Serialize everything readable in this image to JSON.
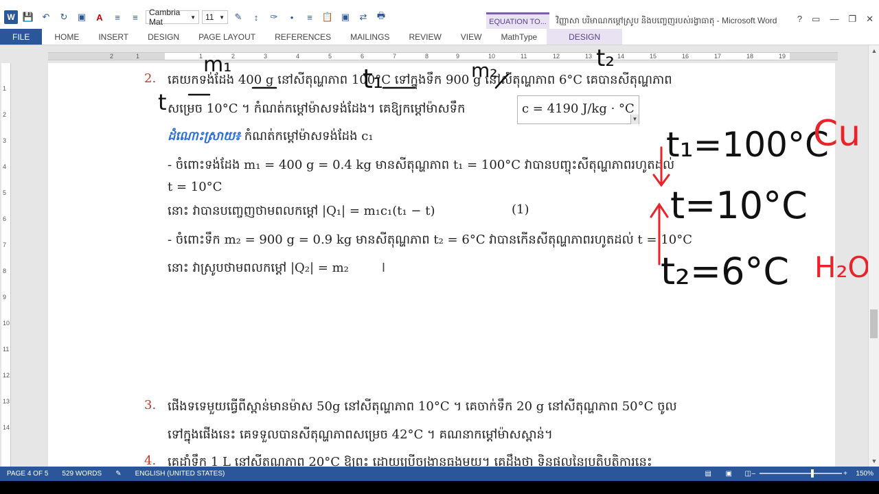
{
  "window": {
    "title": "វិញ្ញាសា បរិមាណកម្ដៅស្រូប និងបញ្ចេញរបស់រង្វាធាតុ - Microsoft Word",
    "controls": [
      "?",
      "▭",
      "—",
      "❐",
      "✕"
    ]
  },
  "quick_access": {
    "logo": "W",
    "font_name": "Cambria Mat",
    "font_size": "11"
  },
  "context_tab_header": "EQUATION TO...",
  "ribbon_tabs": [
    "FILE",
    "HOME",
    "INSERT",
    "DESIGN",
    "PAGE LAYOUT",
    "REFERENCES",
    "MAILINGS",
    "REVIEW",
    "VIEW",
    "MathType",
    "DESIGN"
  ],
  "ruler_numbers": [
    "2",
    "1",
    "1",
    "2",
    "3",
    "4",
    "5",
    "6",
    "7",
    "8",
    "9",
    "10",
    "11",
    "12",
    "13",
    "14",
    "15",
    "16",
    "17",
    "18",
    "19"
  ],
  "vruler_numbers": [
    "1",
    "2",
    "3",
    "4",
    "5",
    "6",
    "7",
    "8",
    "9",
    "10",
    "11",
    "12",
    "13",
    "14"
  ],
  "document": {
    "p2_num": "2.",
    "p2_line1": "គេយកទង់ដែង 400 g នៅសីតុណ្ហភាព 100°C ទៅក្នុងទឹក 900 g នៅសីតុណ្ហភាព 6°C គេបានសីតុណ្ហភាព",
    "p2_line2": "សម្រេច 10°C ។ កំណត់កម្ដៅម៉ាសទង់ដែង។ គេឱ្យកម្ដៅម៉ាសទឹក",
    "equation": "c = 4190 J/kg · °C",
    "heading": "ដំណោះស្រាយ៖",
    "heading_rest": "កំណត់កម្ដៅម៉ាសទង់ដែង c₁",
    "b1_line1": "- ចំពោះទង់ដែង m₁ = 400 g = 0.4 kg មានសីតុណ្ហភាព t₁ = 100°C វាបានបញ្ចុះសីតុណ្ហភាពរហូតដល់",
    "b1_line2": "t = 10°C",
    "b1_line3": "នោះ វាបានបញ្ចេញថាមពលកម្ដៅ |Q₁| = m₁c₁(t₁ − t)",
    "b1_eqnum": "(1)",
    "b2_line1": "- ចំពោះទឹក m₂ = 900 g = 0.9 kg មានសីតុណ្ហភាព t₂ = 6°C វាបានកើនសីតុណ្ហភាពរហូតដល់ t = 10°C",
    "b2_line2": "នោះ វាស្រូបថាមពលកម្ដៅ |Q₂| = m₂",
    "p3_num": "3.",
    "p3_line1": "ផើងទទេមួយធ្វើពីស្ពាន់មានម៉ាស 50g នៅសីតុណ្ហភាព 10°C ។ គេចាក់ទឹក 20 g នៅសីតុណ្ហភាព 50°C ចូល",
    "p3_line2": "ទៅក្នុងផើងនេះ គេទទួលបានសីតុណ្ហភាពសម្រេច 42°C ។ គណនាកម្ដៅម៉ាសស្ពាន់។",
    "p4_num": "4.",
    "p4_line1": "គេដាំទឹក 1 L នៅសីតុណ្ហភាព 20°C ឱ្យពុះ ដោយប្រើចង្ក្រានធុងមួយ។ គេដឹងថា ទិន្នផលនៃប្រតិបត្តិការនេះ"
  },
  "annotations": {
    "m1": "m₁",
    "m2": "m₂",
    "t1": "t₁",
    "t2_top": "t₂",
    "t_left": "t",
    "big_t1": "t₁=100°C",
    "big_t": "t=10°C",
    "big_t2": "t₂=6°C",
    "cu": "Cu",
    "h2o": "H₂O"
  },
  "status": {
    "page": "PAGE 4 OF 5",
    "words": "529 WORDS",
    "language": "ENGLISH (UNITED STATES)",
    "zoom": "150%"
  },
  "colors": {
    "word_blue": "#2b579a",
    "context_purple": "#7e5fa5",
    "list_number": "#c0392b",
    "heading_blue": "#2a6ed8",
    "ink_black": "#111111",
    "ink_red": "#e8232a"
  }
}
